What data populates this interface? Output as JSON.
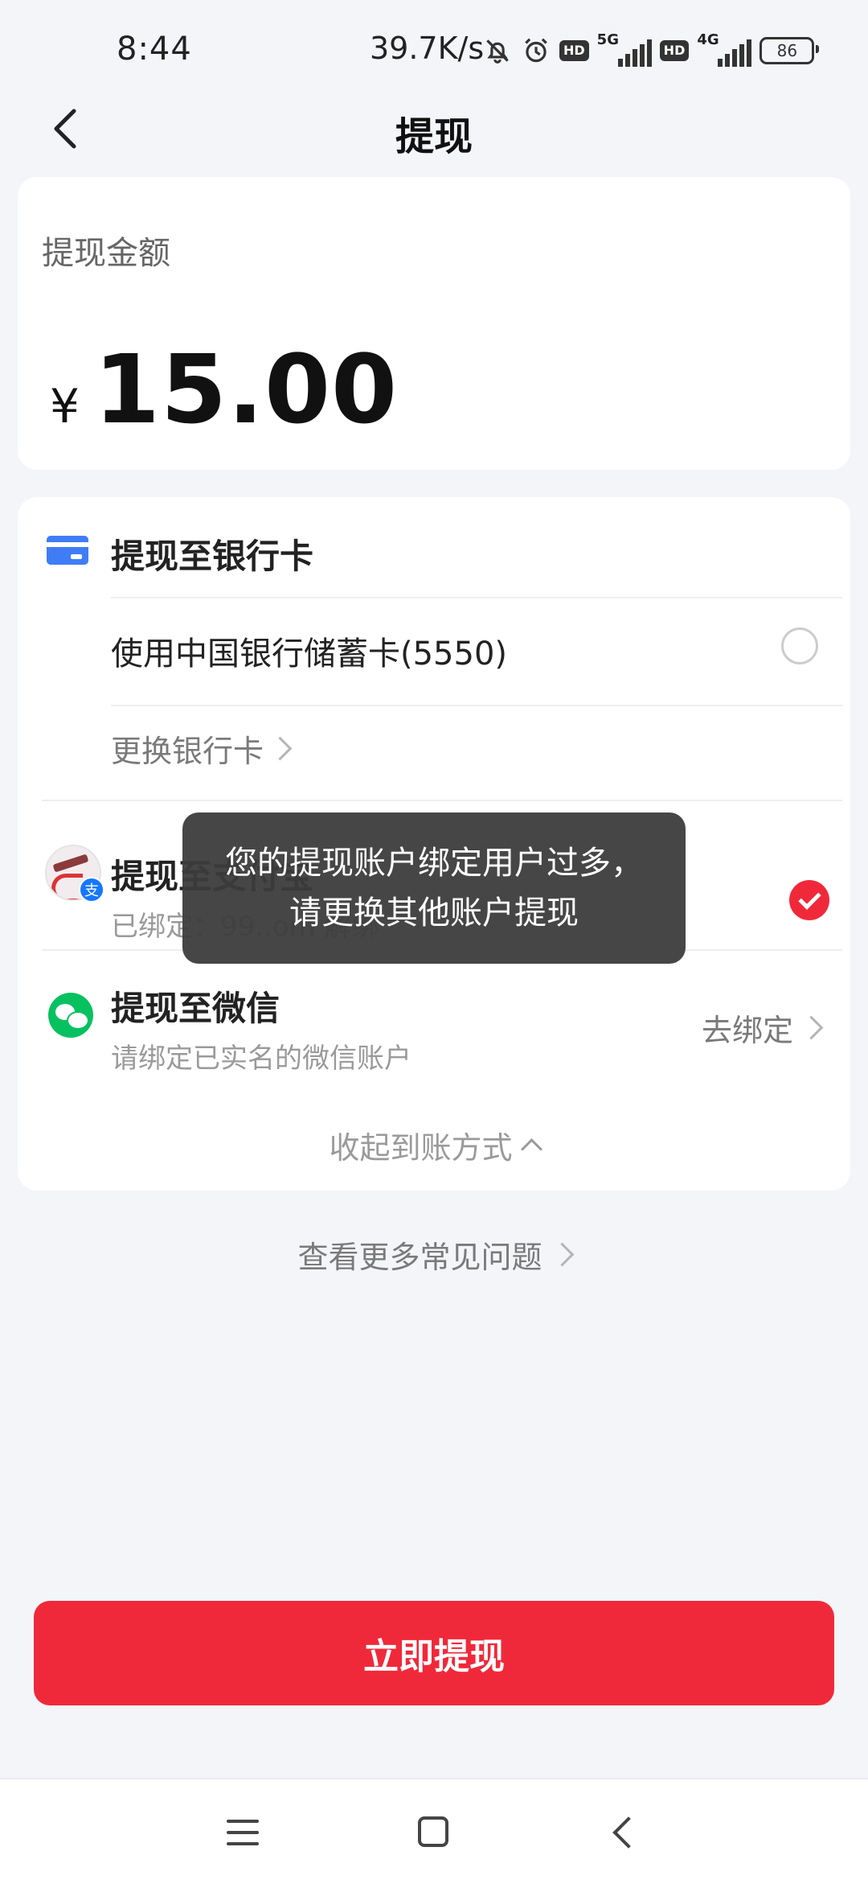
{
  "status_bar": {
    "time": "8:44",
    "net_speed": "39.7K/s",
    "hd1": "HD",
    "net1": "5G",
    "hd2": "HD",
    "net2": "4G",
    "battery": "86",
    "icons": [
      "mute-bell-icon",
      "alarm-icon"
    ]
  },
  "header": {
    "title": "提现",
    "back_icon": "chevron-left-icon"
  },
  "amount": {
    "label": "提现金额",
    "currency": "¥",
    "value": "15.00"
  },
  "methods": {
    "bank": {
      "title": "提现至银行卡",
      "card_label": "使用中国银行储蓄卡(5550)",
      "change_label": "更换银行卡"
    },
    "alipay": {
      "title": "提现至支付宝",
      "badge": "支",
      "subtitle": "已绑定：99..om  解绑"
    },
    "wechat": {
      "title": "提现至微信",
      "subtitle": "请绑定已实名的微信账户",
      "bind_label": "去绑定"
    },
    "collapse_label": "收起到账方式"
  },
  "faq_label": "查看更多常见问题",
  "toast": "您的提现账户绑定用户过多，请更换其他账户提现",
  "submit_label": "立即提现",
  "colors": {
    "accent": "#f0293a",
    "bank_icon": "#3f7df7",
    "wechat": "#07c160",
    "alipay_badge": "#1677ff",
    "background": "#f4f5f9"
  }
}
